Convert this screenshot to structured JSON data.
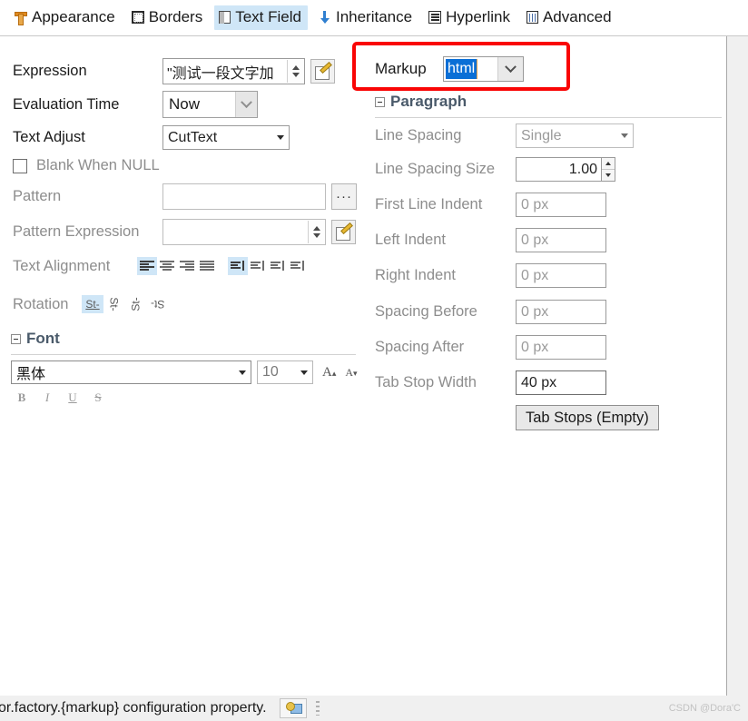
{
  "tabs": [
    {
      "label": "Appearance",
      "icon": "tsquare-icon",
      "active": false
    },
    {
      "label": "Borders",
      "icon": "borders-icon",
      "active": false
    },
    {
      "label": "Text Field",
      "icon": "text-field-icon",
      "active": true
    },
    {
      "label": "Inheritance",
      "icon": "down-arrow-icon",
      "active": false
    },
    {
      "label": "Hyperlink",
      "icon": "hyperlink-icon",
      "active": false
    },
    {
      "label": "Advanced",
      "icon": "advanced-icon",
      "active": false
    }
  ],
  "left": {
    "expression": {
      "label": "Expression",
      "value": "\"测试一段文字加"
    },
    "evaluation_time": {
      "label": "Evaluation Time",
      "value": "Now"
    },
    "text_adjust": {
      "label": "Text Adjust",
      "value": "CutText"
    },
    "blank_when_null": {
      "label": "Blank When NULL",
      "checked": false
    },
    "pattern": {
      "label": "Pattern",
      "value": "",
      "button": "..."
    },
    "pattern_expression": {
      "label": "Pattern Expression",
      "value": ""
    },
    "text_alignment": {
      "label": "Text Alignment",
      "horizontal": [
        "align-left",
        "align-center",
        "align-right",
        "align-justify"
      ],
      "horizontal_selected": 0,
      "vertical": [
        "align-top",
        "align-middle",
        "align-bottom",
        "align-justified"
      ],
      "vertical_selected": 0
    },
    "rotation": {
      "label": "Rotation",
      "options": [
        "rotate-none",
        "rotate-left",
        "rotate-right",
        "rotate-upside-down"
      ],
      "selected": 0,
      "glyph": "St-"
    },
    "font": {
      "section_title": "Font",
      "family": "黑体",
      "size": "10",
      "increase_label": "A",
      "decrease_label": "A",
      "styles": [
        "B",
        "I",
        "U",
        "S"
      ]
    }
  },
  "right": {
    "markup": {
      "label": "Markup",
      "value": "html",
      "selected": true
    },
    "paragraph": {
      "section_title": "Paragraph",
      "fields": [
        {
          "label": "Line Spacing",
          "value": "Single",
          "kind": "dropdown"
        },
        {
          "label": "Line Spacing Size",
          "value": "1.00",
          "kind": "spinner"
        },
        {
          "label": "First Line Indent",
          "value": "0 px",
          "kind": "text"
        },
        {
          "label": "Left Indent",
          "value": "0 px",
          "kind": "text"
        },
        {
          "label": "Right Indent",
          "value": "0 px",
          "kind": "text"
        },
        {
          "label": "Spacing Before",
          "value": "0 px",
          "kind": "text"
        },
        {
          "label": "Spacing After",
          "value": "0 px",
          "kind": "text"
        },
        {
          "label": "Tab Stop Width",
          "value": "40 px",
          "kind": "text"
        }
      ],
      "tab_stops_button": "Tab Stops (Empty)"
    }
  },
  "status": {
    "message": "or.factory.{markup} configuration property.",
    "icon": "computer-icon",
    "watermark": "CSDN @Dora'C"
  },
  "colors": {
    "accent_selection": "#0a6fd6",
    "tab_active": "#cfe6f7",
    "highlight_box": "#f90505",
    "section_title": "#4a5a6a"
  }
}
